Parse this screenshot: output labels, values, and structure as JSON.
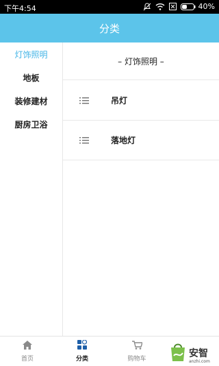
{
  "status_bar": {
    "time": "下午4:54",
    "battery": "40%"
  },
  "header": {
    "title": "分类"
  },
  "sidebar": {
    "items": [
      {
        "label": "灯饰照明",
        "active": true
      },
      {
        "label": "地板",
        "active": false
      },
      {
        "label": "装修建材",
        "active": false
      },
      {
        "label": "厨房卫浴",
        "active": false
      }
    ]
  },
  "content": {
    "section_title": "– 灯饰照明 –",
    "items": [
      {
        "label": "吊灯",
        "icon": "list-icon"
      },
      {
        "label": "落地灯",
        "icon": "list-icon"
      }
    ]
  },
  "bottom_nav": {
    "items": [
      {
        "label": "首页",
        "icon": "home-icon",
        "active": false
      },
      {
        "label": "分类",
        "icon": "category-icon",
        "active": true
      },
      {
        "label": "购物车",
        "icon": "cart-icon",
        "active": false
      }
    ]
  },
  "watermark": {
    "text": "安智",
    "url": "anzhi.com"
  },
  "colors": {
    "header_bg": "#5cc4ea",
    "active_text": "#43b4e6"
  }
}
